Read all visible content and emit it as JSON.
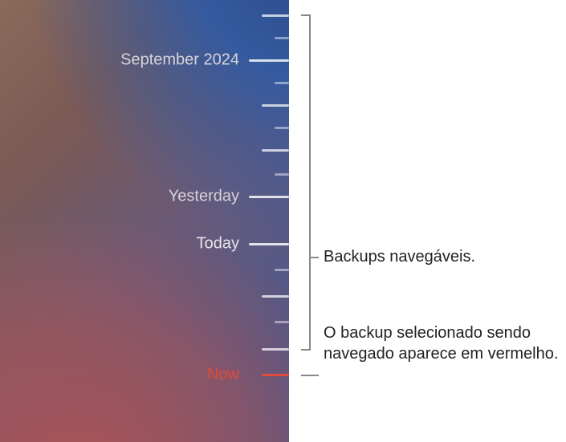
{
  "timeline": {
    "labels": {
      "month": "September 2024",
      "yesterday": "Yesterday",
      "today": "Today",
      "now": "Now"
    },
    "now_color": "#e24a3b"
  },
  "callouts": {
    "navigable": "Backups navegáveis.",
    "selected": "O backup selecionado sendo navegado aparece em vermelho."
  }
}
